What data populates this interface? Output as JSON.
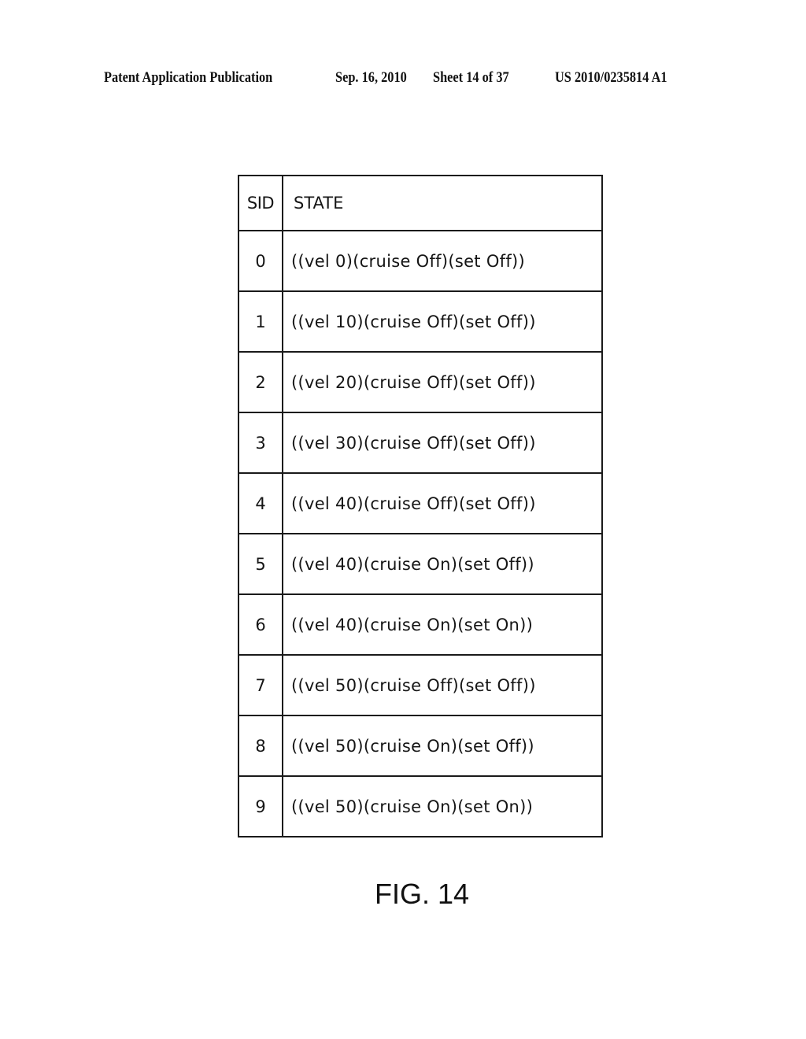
{
  "header": {
    "publication_type": "Patent Application Publication",
    "date": "Sep. 16, 2010",
    "sheet": "Sheet 14 of 37",
    "publication_number": "US 2010/0235814 A1"
  },
  "table": {
    "columns": [
      "SID",
      "STATE"
    ],
    "rows": [
      {
        "sid": "0",
        "state": "((vel 0)(cruise Off)(set Off))"
      },
      {
        "sid": "1",
        "state": "((vel 10)(cruise Off)(set Off))"
      },
      {
        "sid": "2",
        "state": "((vel 20)(cruise Off)(set Off))"
      },
      {
        "sid": "3",
        "state": "((vel 30)(cruise Off)(set Off))"
      },
      {
        "sid": "4",
        "state": "((vel 40)(cruise Off)(set Off))"
      },
      {
        "sid": "5",
        "state": "((vel 40)(cruise On)(set Off))"
      },
      {
        "sid": "6",
        "state": "((vel 40)(cruise On)(set On))"
      },
      {
        "sid": "7",
        "state": "((vel 50)(cruise Off)(set Off))"
      },
      {
        "sid": "8",
        "state": "((vel 50)(cruise On)(set Off))"
      },
      {
        "sid": "9",
        "state": "((vel 50)(cruise On)(set On))"
      }
    ]
  },
  "figure": {
    "caption": "FIG. 14"
  }
}
